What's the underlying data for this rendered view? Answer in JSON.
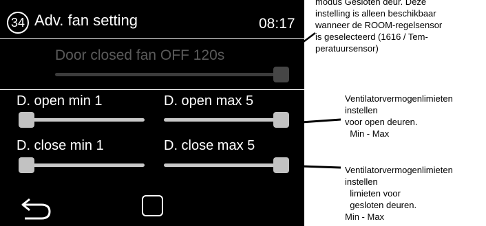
{
  "screen": {
    "number": "34",
    "title": "Adv. fan setting",
    "clock": "08:17",
    "door_closed_text": "Door closed fan OFF  120s",
    "sliders": [
      {
        "label": "D. open min 1",
        "level": 0.0
      },
      {
        "label": "D. open max 5",
        "level": 1.0
      },
      {
        "label": "D. close min 1",
        "level": 0.0
      },
      {
        "label": "D. close max 5",
        "level": 1.0
      }
    ],
    "door_closed_level": 1.0,
    "nav": {
      "back_icon": "back-arrow-icon",
      "home_icon": "square-home-icon"
    }
  },
  "annotations": {
    "top_note": [
      "modus Gesloten deur. Deze",
      "instelling is alleen beschikbaar",
      "wanneer de ROOM-regelsensor",
      "is geselecteerd (1616 / Tem-",
      "peratuursensor)"
    ],
    "open_note": [
      "Ventilatorvermogenlimieten",
      "instellen",
      "voor open deuren.",
      "  Min - Max"
    ],
    "closed_note": [
      "Ventilatorvermogenlimieten",
      "instellen",
      "  limieten voor",
      "  gesloten deuren.",
      "Min - Max"
    ]
  }
}
